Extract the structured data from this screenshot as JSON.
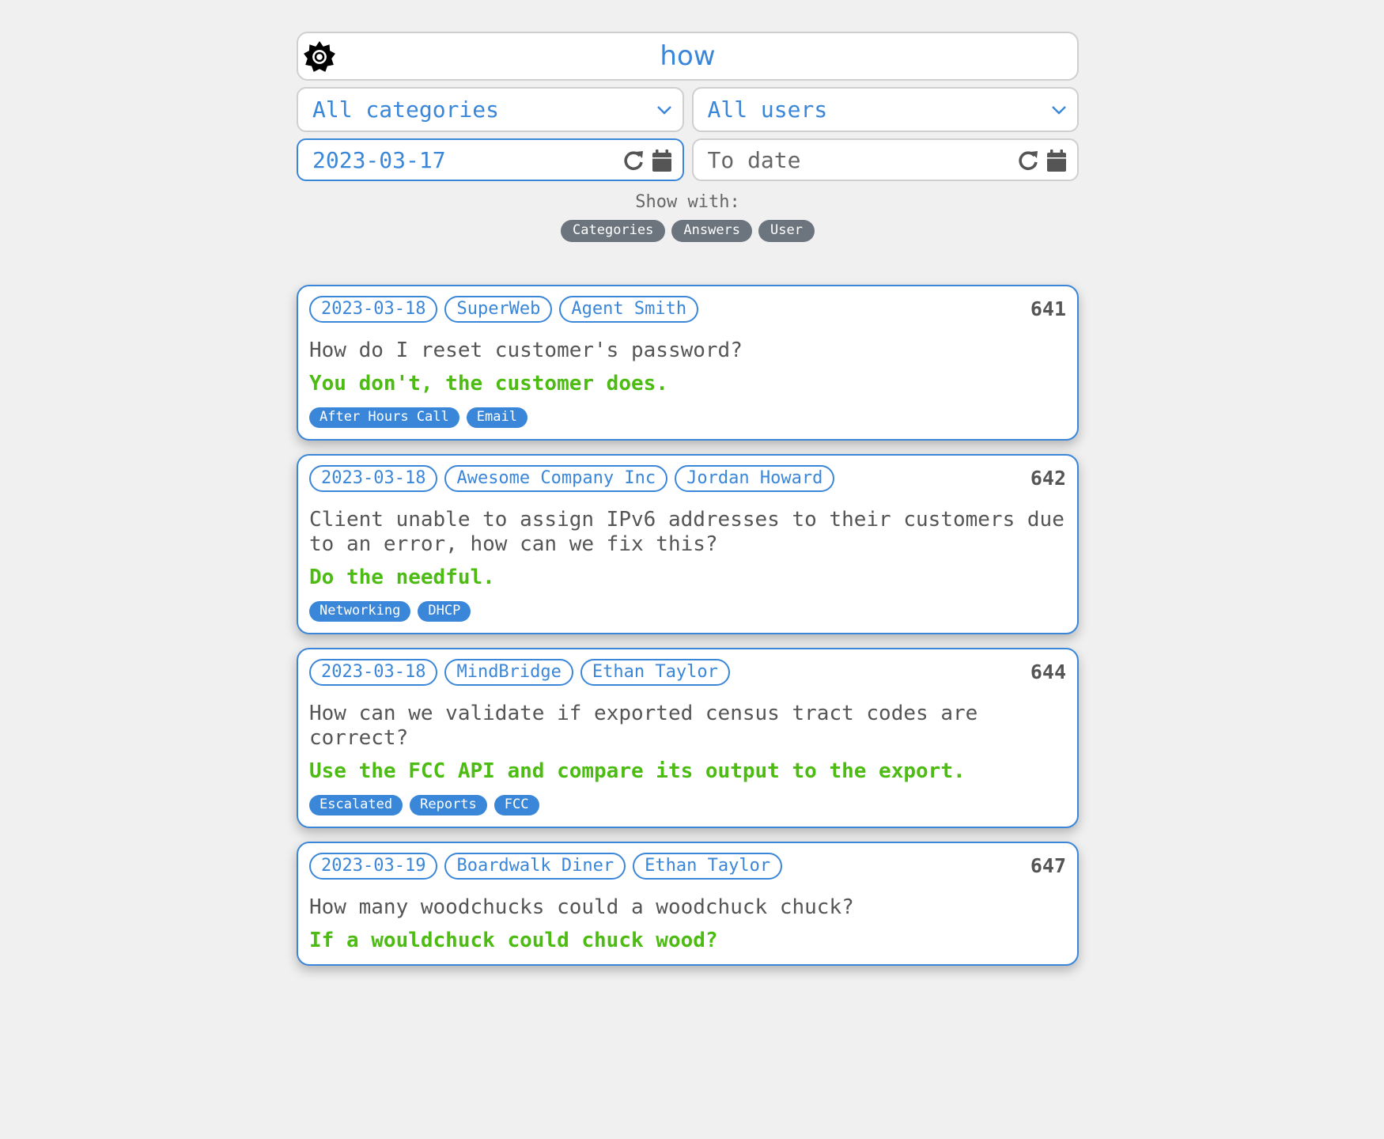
{
  "search": {
    "value": "how"
  },
  "filters": {
    "category": "All categories",
    "user": "All users",
    "from_date": "2023-03-17",
    "to_date_placeholder": "To date"
  },
  "show_with": {
    "label": "Show with:",
    "options": [
      "Categories",
      "Answers",
      "User"
    ]
  },
  "results": [
    {
      "date": "2023-03-18",
      "company": "SuperWeb",
      "user": "Agent Smith",
      "id": "641",
      "question": "How do I reset customer's password?",
      "answer": "You don't, the customer does.",
      "categories": [
        "After Hours Call",
        "Email"
      ]
    },
    {
      "date": "2023-03-18",
      "company": "Awesome Company Inc",
      "user": "Jordan Howard",
      "id": "642",
      "question": "Client unable to assign IPv6 addresses to their customers due to an error, how can we fix this?",
      "answer": "Do the needful.",
      "categories": [
        "Networking",
        "DHCP"
      ]
    },
    {
      "date": "2023-03-18",
      "company": "MindBridge",
      "user": "Ethan Taylor",
      "id": "644",
      "question": "How can we validate if exported census tract codes are correct?",
      "answer": "Use the FCC API and compare its output to the export.",
      "categories": [
        "Escalated",
        "Reports",
        "FCC"
      ]
    },
    {
      "date": "2023-03-19",
      "company": "Boardwalk Diner",
      "user": "Ethan Taylor",
      "id": "647",
      "question": "How many woodchucks could a woodchuck chuck?",
      "answer": "If a wouldchuck could chuck wood?",
      "categories": []
    }
  ]
}
